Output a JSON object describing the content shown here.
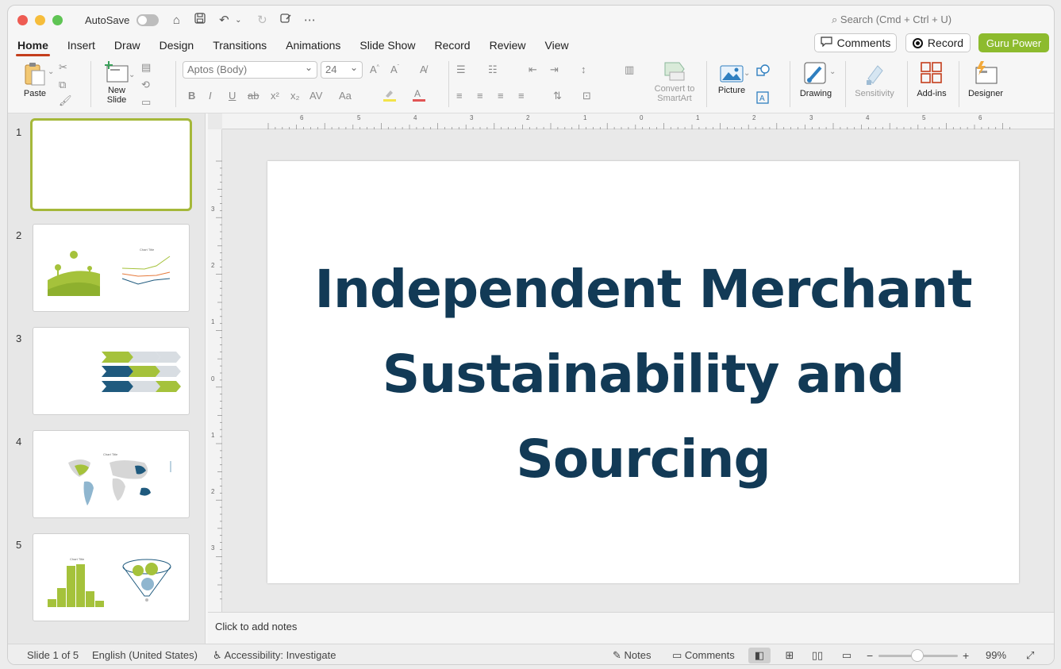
{
  "titlebar": {
    "autosave_label": "AutoSave",
    "search_placeholder": "Search (Cmd + Ctrl + U)"
  },
  "tabs": [
    "Home",
    "Insert",
    "Draw",
    "Design",
    "Transitions",
    "Animations",
    "Slide Show",
    "Record",
    "Review",
    "View"
  ],
  "header_buttons": {
    "comments": "Comments",
    "record": "Record",
    "guru": "Guru Power"
  },
  "ribbon": {
    "paste": "Paste",
    "new_slide_line1": "New",
    "new_slide_line2": "Slide",
    "font_name": "Aptos (Body)",
    "font_size": "24",
    "convert_line1": "Convert to",
    "convert_line2": "SmartArt",
    "picture": "Picture",
    "drawing": "Drawing",
    "sensitivity": "Sensitivity",
    "addins": "Add-ins",
    "designer": "Designer"
  },
  "slides": {
    "numbers": [
      "1",
      "2",
      "3",
      "4",
      "5"
    ],
    "thumb_chart_title": "Chart Title"
  },
  "ruler": {
    "h_labels": [
      "6",
      "5",
      "4",
      "3",
      "2",
      "1",
      "0",
      "1",
      "2",
      "3",
      "4",
      "5",
      "6"
    ],
    "v_labels": [
      "3",
      "2",
      "1",
      "0",
      "1",
      "2",
      "3"
    ]
  },
  "slide": {
    "title_line1": "Independent Merchant",
    "title_line2": "Sustainability and",
    "title_line3": "Sourcing"
  },
  "notes_placeholder": "Click to add notes",
  "status": {
    "slide_count": "Slide 1 of 5",
    "language": "English (United States)",
    "accessibility": "Accessibility: Investigate",
    "notes": "Notes",
    "comments": "Comments",
    "zoom": "99%"
  },
  "colors": {
    "accent_tab": "#c43e1c",
    "guru": "#8dbb2e",
    "title_text": "#123a56",
    "thumb_green": "#a5c23b",
    "thumb_blue": "#1f5a7e"
  }
}
